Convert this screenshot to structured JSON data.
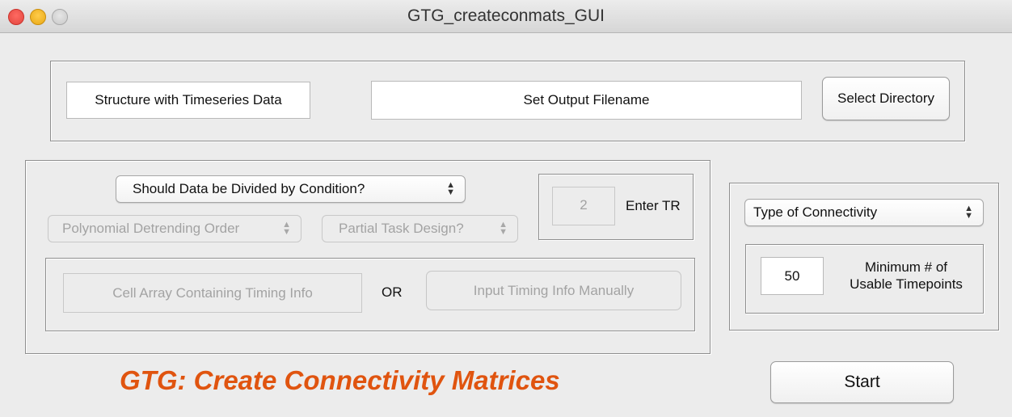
{
  "window": {
    "title": "GTG_createconmats_GUI"
  },
  "top_panel": {
    "timeseries_field": "Structure with Timeseries Data",
    "output_filename_field": "Set Output Filename",
    "select_directory_button": "Select Directory"
  },
  "left_panel": {
    "divide_by_condition_popup": "Should Data be Divided by Condition?",
    "polynomial_detrending_popup": "Polynomial Detrending Order",
    "partial_task_design_popup": "Partial Task Design?",
    "tr": {
      "value": "2",
      "label": "Enter TR"
    },
    "timing": {
      "cell_array_field": "Cell Array Containing Timing Info",
      "or_label": "OR",
      "manual_button": "Input Timing Info Manually"
    }
  },
  "right_panel": {
    "connectivity_popup": "Type of Connectivity",
    "min_timepoints": {
      "value": "50",
      "label_line1": "Minimum # of",
      "label_line2": "Usable Timepoints"
    }
  },
  "start_button": "Start",
  "app_title": "GTG: Create Connectivity Matrices",
  "colors": {
    "app_title": "#e0540f",
    "window_bg": "#ececec",
    "disabled_text": "#a3a3a3"
  }
}
